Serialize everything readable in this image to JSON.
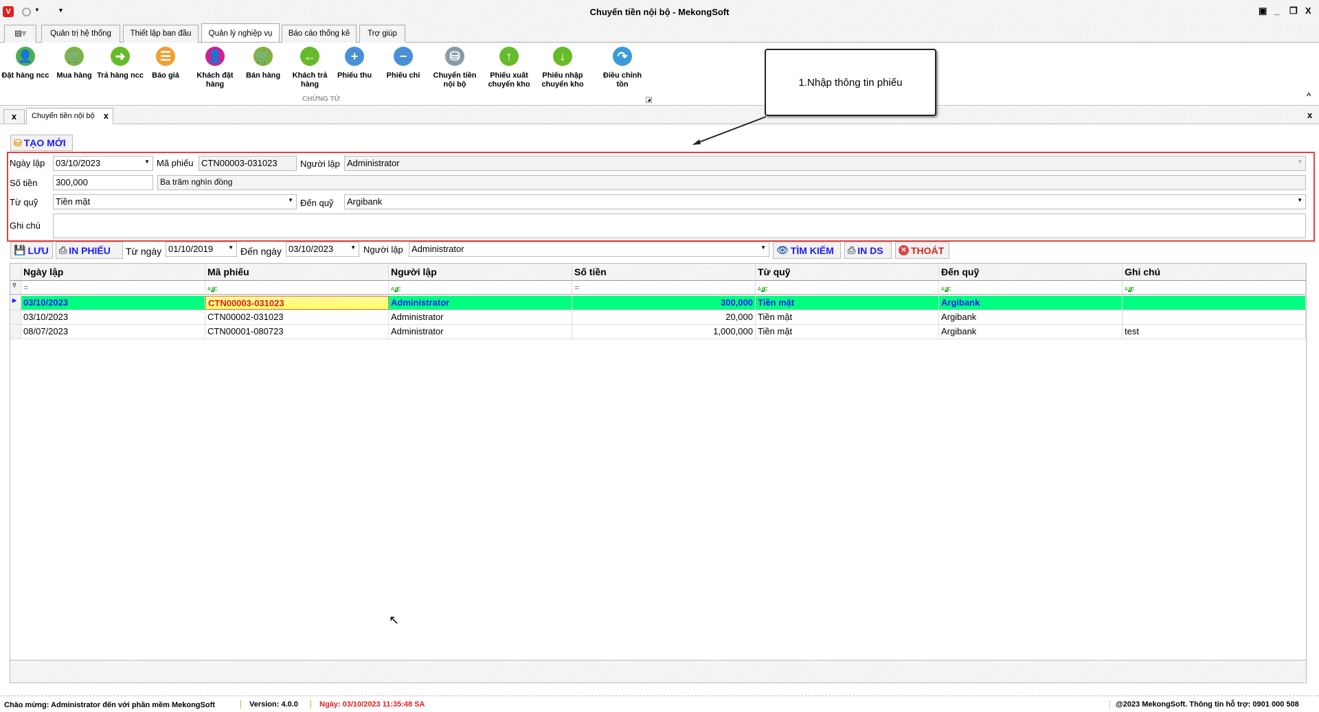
{
  "window": {
    "title": "Chuyển tiền nội bộ - MekongSoft",
    "logo": "V"
  },
  "ribbon_tabs": [
    "Quản trị hệ thống",
    "Thiết lập ban đầu",
    "Quản lý nghiệp vụ",
    "Báo cáo thống kê",
    "Trợ giúp"
  ],
  "ribbon_buttons": [
    {
      "label": "Đặt hàng ncc",
      "color": "#4caf50"
    },
    {
      "label": "Mua hàng",
      "color": "#7cb342"
    },
    {
      "label": "Trả hàng ncc",
      "color": "#66bb2a"
    },
    {
      "label": "Báo giá",
      "color": "#f0a030"
    },
    {
      "label": "Khách đặt hàng",
      "color": "#d02090"
    },
    {
      "label": "Bán hàng",
      "color": "#7cb342"
    },
    {
      "label": "Khách trả hàng",
      "color": "#66bb2a"
    },
    {
      "label": "Phiếu thu",
      "color": "#4a90d9"
    },
    {
      "label": "Phiếu chi",
      "color": "#4a90d9"
    },
    {
      "label": "Chuyển tiền nội bộ",
      "color": "#8a9aa8"
    },
    {
      "label": "Phiếu xuất chuyển kho",
      "color": "#66bb2a"
    },
    {
      "label": "Phiếu nhập chuyển kho",
      "color": "#66bb2a"
    },
    {
      "label": "Điều chỉnh tồn",
      "color": "#3a9ad9"
    }
  ],
  "ribbon_group": "CHỨNG TỪ",
  "doc_tab": "Chuyển tiền nội bộ",
  "callout": "1.Nhập thông tin phiếu",
  "form": {
    "new_label": "TẠO MỚI",
    "ngay_lap_label": "Ngày lập",
    "ngay_lap": "03/10/2023",
    "ma_phieu_label": "Mã phiếu",
    "ma_phieu": "CTN00003-031023",
    "nguoi_lap_label": "Người lập",
    "nguoi_lap": "Administrator",
    "so_tien_label": "Số tiền",
    "so_tien": "300,000",
    "so_tien_chu": "Ba trăm nghìn đồng",
    "tu_quy_label": "Từ quỹ",
    "tu_quy": "Tiền mặt",
    "den_quy_label": "Đến quỹ",
    "den_quy": "Argibank",
    "ghi_chu_label": "Ghi chú",
    "ghi_chu": ""
  },
  "toolbar": {
    "save": "LƯU",
    "print": "IN PHIẾU",
    "from_label": "Từ ngày",
    "from": "01/10/2019",
    "to_label": "Đến ngày",
    "to": "03/10/2023",
    "user_label": "Người lập",
    "user": "Administrator",
    "search": "TÌM KIẾM",
    "print_list": "IN DS",
    "exit": "THOÁT"
  },
  "grid": {
    "columns": [
      "Ngày lập",
      "Mã phiếu",
      "Người lập",
      "Số tiền",
      "Từ quỹ",
      "Đến quỹ",
      "Ghi chú"
    ],
    "rows": [
      [
        "03/10/2023",
        "CTN00003-031023",
        "Administrator",
        "300,000",
        "Tiền mặt",
        "Argibank",
        ""
      ],
      [
        "03/10/2023",
        "CTN00002-031023",
        "Administrator",
        "20,000",
        "Tiền mặt",
        "Argibank",
        ""
      ],
      [
        "08/07/2023",
        "CTN00001-080723",
        "Administrator",
        "1,000,000",
        "Tiền mặt",
        "Argibank",
        "test"
      ]
    ]
  },
  "status": {
    "welcome": "Chào mừng: Administrator đến với phần mềm MekongSoft",
    "version": "Version: 4.0.0",
    "date": "Ngày: 03/10/2023 11:35:48 SA",
    "copyright": "@2023 MekongSoft. Thông tin hỗ trợ: 0901 000 508"
  }
}
